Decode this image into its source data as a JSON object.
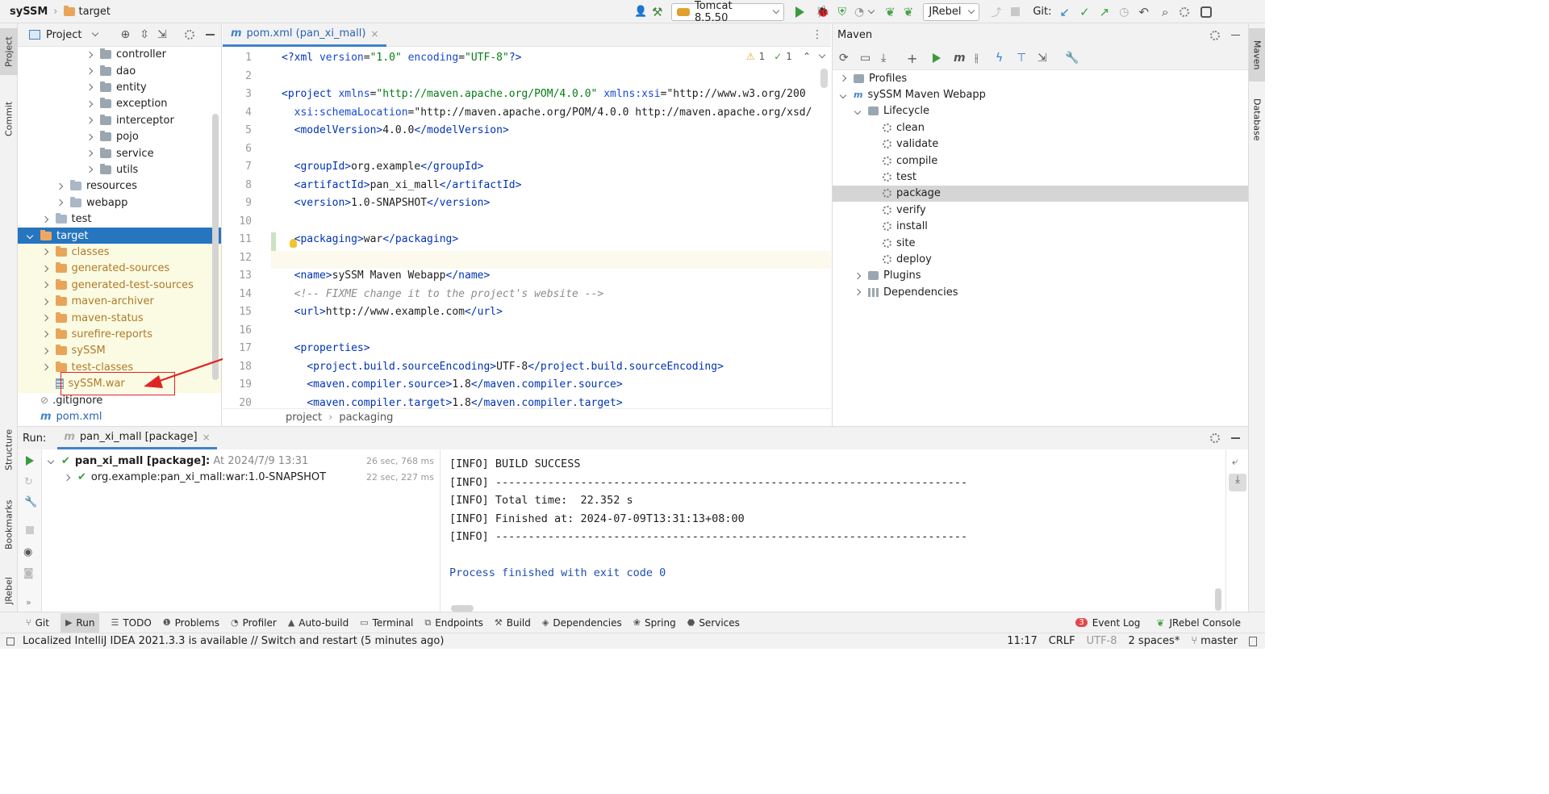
{
  "navbar": {
    "project": "sySSM",
    "crumb": "target",
    "run_config": "Tomcat 8.5.50",
    "jrebel": "JRebel",
    "git_label": "Git:"
  },
  "left_strip": {
    "project": "Project",
    "commit": "Commit",
    "structure": "Structure",
    "bookmarks": "Bookmarks",
    "jrebel": "JRebel"
  },
  "right_strip": {
    "maven": "Maven",
    "database": "Database"
  },
  "project_panel": {
    "title": "Project",
    "items": [
      {
        "label": "controller",
        "indent": 5,
        "type": "pkg",
        "expander": "right"
      },
      {
        "label": "dao",
        "indent": 5,
        "type": "pkg",
        "expander": "right"
      },
      {
        "label": "entity",
        "indent": 5,
        "type": "pkg",
        "expander": "right"
      },
      {
        "label": "exception",
        "indent": 5,
        "type": "pkg",
        "expander": "right"
      },
      {
        "label": "interceptor",
        "indent": 5,
        "type": "pkg",
        "expander": "right"
      },
      {
        "label": "pojo",
        "indent": 5,
        "type": "pkg",
        "expander": "right"
      },
      {
        "label": "service",
        "indent": 5,
        "type": "pkg",
        "expander": "right"
      },
      {
        "label": "utils",
        "indent": 5,
        "type": "pkg",
        "expander": "right"
      },
      {
        "label": "resources",
        "indent": 3,
        "type": "res",
        "expander": "right"
      },
      {
        "label": "webapp",
        "indent": 3,
        "type": "web",
        "expander": "right"
      },
      {
        "label": "test",
        "indent": 2,
        "type": "plain",
        "expander": "right"
      },
      {
        "label": "target",
        "indent": 1,
        "type": "excluded",
        "expander": "down",
        "selected": true
      },
      {
        "label": "classes",
        "indent": 2,
        "type": "excluded",
        "expander": "right"
      },
      {
        "label": "generated-sources",
        "indent": 2,
        "type": "excluded",
        "expander": "right"
      },
      {
        "label": "generated-test-sources",
        "indent": 2,
        "type": "excluded",
        "expander": "right"
      },
      {
        "label": "maven-archiver",
        "indent": 2,
        "type": "excluded",
        "expander": "right"
      },
      {
        "label": "maven-status",
        "indent": 2,
        "type": "excluded",
        "expander": "right"
      },
      {
        "label": "surefire-reports",
        "indent": 2,
        "type": "excluded",
        "expander": "right"
      },
      {
        "label": "sySSM",
        "indent": 2,
        "type": "excluded",
        "expander": "right"
      },
      {
        "label": "test-classes",
        "indent": 2,
        "type": "excluded",
        "expander": "right"
      },
      {
        "label": "sySSM.war",
        "indent": 2,
        "type": "war",
        "expander": "none",
        "highlighted": true
      },
      {
        "label": ".gitignore",
        "indent": 1,
        "type": "gitignore",
        "expander": "none"
      },
      {
        "label": "pom.xml",
        "indent": 1,
        "type": "pom",
        "expander": "none"
      }
    ]
  },
  "editor": {
    "tab": "pom.xml (pan_xi_mall)",
    "inspections": {
      "warnings": "1",
      "weak": "1"
    },
    "lines": [
      {
        "n": "1",
        "t": "<?xml version=\"1.0\" encoding=\"UTF-8\"?>"
      },
      {
        "n": "2",
        "t": ""
      },
      {
        "n": "3",
        "t": "<project xmlns=\"http://maven.apache.org/POM/4.0.0\" xmlns:xsi=\"http://www.w3.org/200"
      },
      {
        "n": "4",
        "t": "  xsi:schemaLocation=\"http://maven.apache.org/POM/4.0.0 http://maven.apache.org/xsd/"
      },
      {
        "n": "5",
        "t": "  <modelVersion>4.0.0</modelVersion>"
      },
      {
        "n": "6",
        "t": ""
      },
      {
        "n": "7",
        "t": "  <groupId>org.example</groupId>"
      },
      {
        "n": "8",
        "t": "  <artifactId>pan_xi_mall</artifactId>"
      },
      {
        "n": "9",
        "t": "  <version>1.0-SNAPSHOT</version>"
      },
      {
        "n": "10",
        "t": ""
      },
      {
        "n": "11",
        "t": "  <packaging>war</packaging>"
      },
      {
        "n": "12",
        "t": ""
      },
      {
        "n": "13",
        "t": "  <name>sySSM Maven Webapp</name>"
      },
      {
        "n": "14",
        "t": "  <!-- FIXME change it to the project's website -->"
      },
      {
        "n": "15",
        "t": "  <url>http://www.example.com</url>"
      },
      {
        "n": "16",
        "t": ""
      },
      {
        "n": "17",
        "t": "  <properties>"
      },
      {
        "n": "18",
        "t": "    <project.build.sourceEncoding>UTF-8</project.build.sourceEncoding>"
      },
      {
        "n": "19",
        "t": "    <maven.compiler.source>1.8</maven.compiler.source>"
      },
      {
        "n": "20",
        "t": "    <maven.compiler.target>1.8</maven.compiler.target>"
      }
    ],
    "breadcrumb": [
      "project",
      "packaging"
    ]
  },
  "maven": {
    "title": "Maven",
    "profiles": "Profiles",
    "project": "sySSM Maven Webapp",
    "lifecycle": "Lifecycle",
    "phases": [
      "clean",
      "validate",
      "compile",
      "test",
      "package",
      "verify",
      "install",
      "site",
      "deploy"
    ],
    "selected_phase": "package",
    "plugins": "Plugins",
    "dependencies": "Dependencies"
  },
  "run": {
    "label": "Run:",
    "tab": "pan_xi_mall [package]",
    "tree": [
      {
        "title": "pan_xi_mall [package]:",
        "sub": " At 2024/7/9 13:31",
        "time": "26 sec, 768 ms"
      },
      {
        "title": "org.example:pan_xi_mall:war:1.0-SNAPSHOT",
        "sub": "",
        "time": "22 sec, 227 ms"
      }
    ],
    "console": [
      "[INFO] BUILD SUCCESS",
      "[INFO] ------------------------------------------------------------------------",
      "[INFO] Total time:  22.352 s",
      "[INFO] Finished at: 2024-07-09T13:31:13+08:00",
      "[INFO] ------------------------------------------------------------------------",
      "",
      "Process finished with exit code 0"
    ]
  },
  "bottom_tabs": [
    "Git",
    "Run",
    "TODO",
    "Problems",
    "Profiler",
    "Auto-build",
    "Terminal",
    "Endpoints",
    "Build",
    "Dependencies",
    "Spring",
    "Services"
  ],
  "bottom_right": {
    "event_log": "Event Log",
    "event_count": "3",
    "jrebel_console": "JRebel Console"
  },
  "status": {
    "message": "Localized IntelliJ IDEA 2021.3.3 is available // Switch and restart (5 minutes ago)",
    "position": "11:17",
    "line_sep": "CRLF",
    "encoding": "UTF-8",
    "indent": "2 spaces*",
    "branch": "master"
  },
  "colors": {
    "selection": "#2675bf",
    "excluded_bg": "#fbfbe3",
    "excluded_folder": "#e8a55a",
    "annotation": "#e02424",
    "maven_selected": "#d5d5d5"
  }
}
